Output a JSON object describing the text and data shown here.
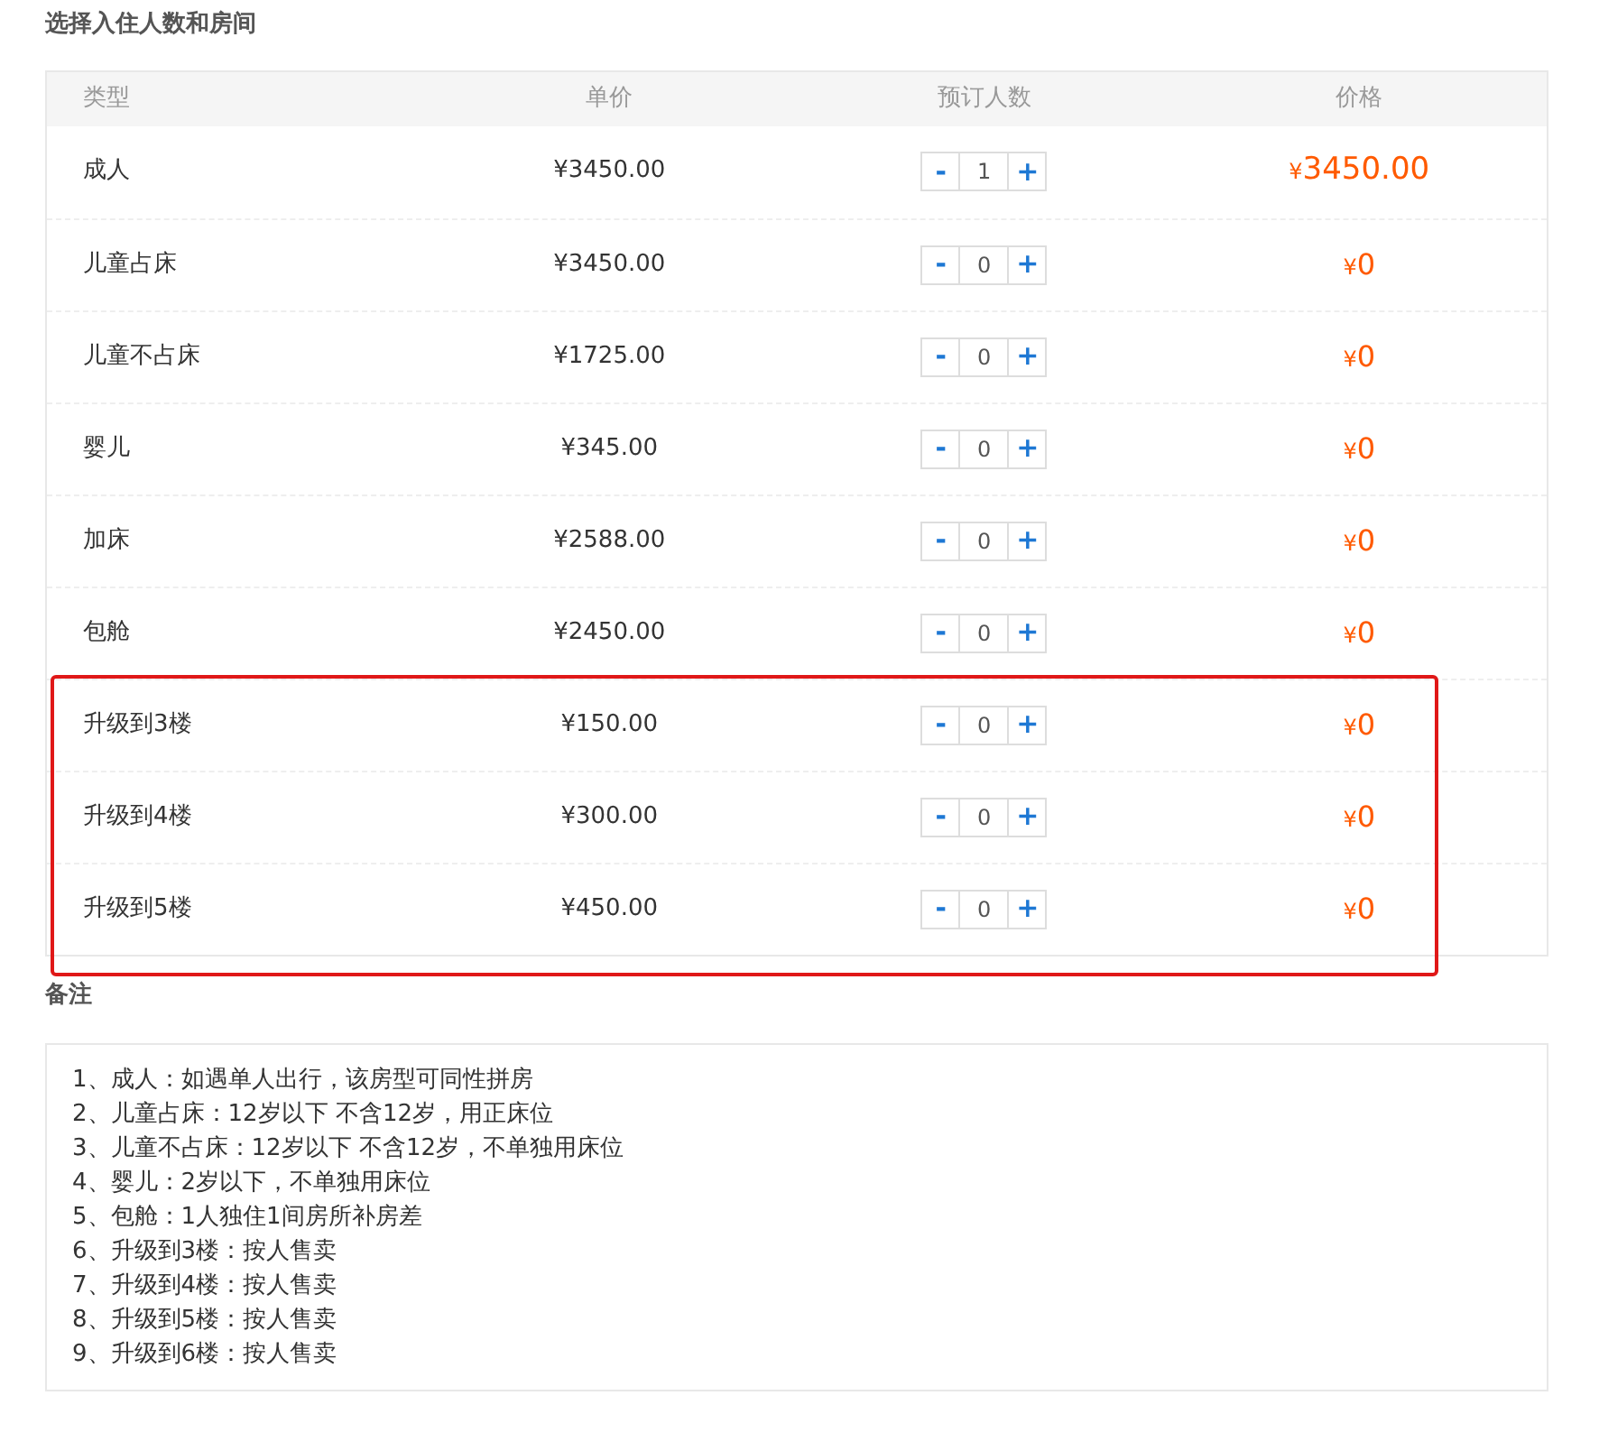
{
  "title": "选择入住人数和房间",
  "columns": [
    "类型",
    "单价",
    "预订人数",
    "价格"
  ],
  "rows": [
    {
      "type": "成人",
      "unit_price": "¥3450.00",
      "count": "1",
      "currency": "¥",
      "total": "3450.00",
      "highlighted": false
    },
    {
      "type": "儿童占床",
      "unit_price": "¥3450.00",
      "count": "0",
      "currency": "¥",
      "total": "0",
      "highlighted": false
    },
    {
      "type": "儿童不占床",
      "unit_price": "¥1725.00",
      "count": "0",
      "currency": "¥",
      "total": "0",
      "highlighted": false
    },
    {
      "type": "婴儿",
      "unit_price": "¥345.00",
      "count": "0",
      "currency": "¥",
      "total": "0",
      "highlighted": false
    },
    {
      "type": "加床",
      "unit_price": "¥2588.00",
      "count": "0",
      "currency": "¥",
      "total": "0",
      "highlighted": false
    },
    {
      "type": "包舱",
      "unit_price": "¥2450.00",
      "count": "0",
      "currency": "¥",
      "total": "0",
      "highlighted": false
    },
    {
      "type": "升级到3楼",
      "unit_price": "¥150.00",
      "count": "0",
      "currency": "¥",
      "total": "0",
      "highlighted": true
    },
    {
      "type": "升级到4楼",
      "unit_price": "¥300.00",
      "count": "0",
      "currency": "¥",
      "total": "0",
      "highlighted": true
    },
    {
      "type": "升级到5楼",
      "unit_price": "¥450.00",
      "count": "0",
      "currency": "¥",
      "total": "0",
      "highlighted": true
    }
  ],
  "minus_label": "-",
  "plus_label": "+",
  "notes_title": "备注",
  "notes": [
    "1、成人：如遇单人出行，该房型可同性拼房",
    "2、儿童占床：12岁以下 不含12岁，用正床位",
    "3、儿童不占床：12岁以下 不含12岁，不单独用床位",
    "4、婴儿：2岁以下，不单独用床位",
    "5、包舱：1人独住1间房所补房差",
    "6、升级到3楼：按人售卖",
    "7、升级到4楼：按人售卖",
    "8、升级到5楼：按人售卖",
    "9、升级到6楼：按人售卖"
  ]
}
